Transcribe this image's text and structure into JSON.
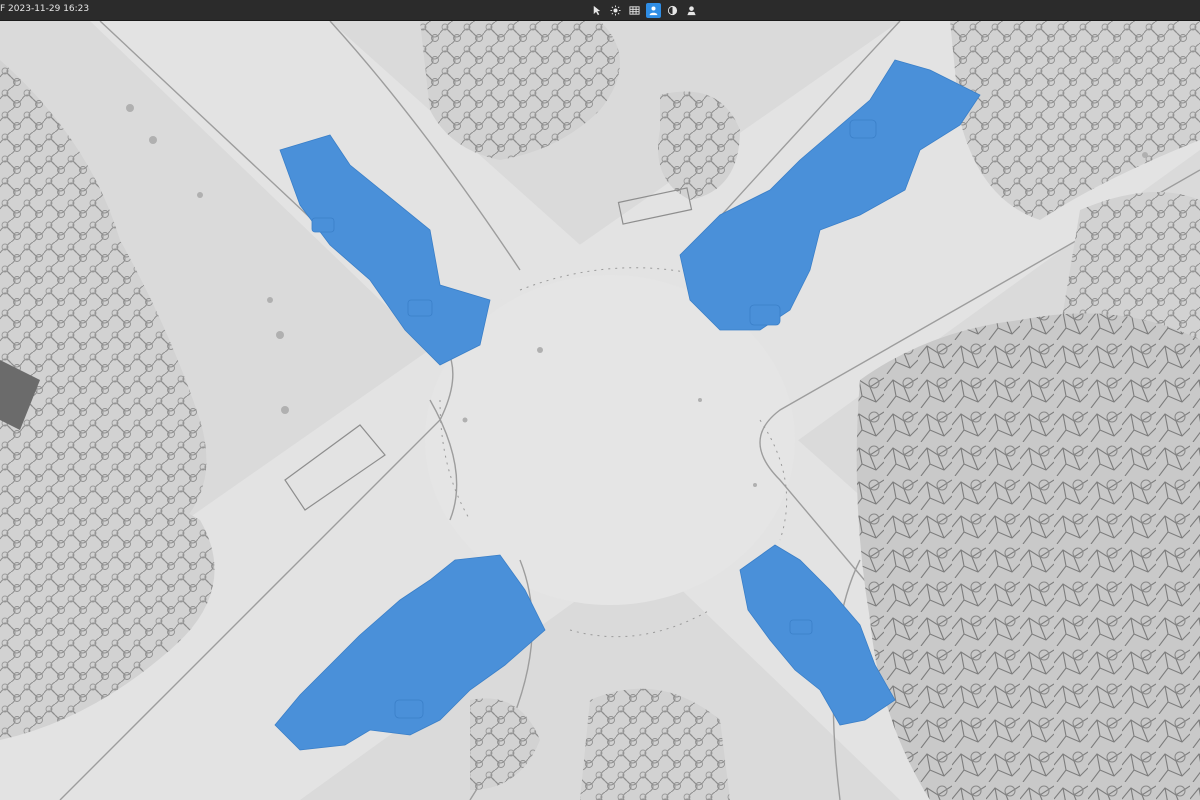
{
  "window": {
    "title": "F 2023-11-29 16:23"
  },
  "toolbar": {
    "tools": [
      {
        "icon": "pointer-icon",
        "active": false
      },
      {
        "icon": "light-icon",
        "active": false
      },
      {
        "icon": "grid-icon",
        "active": false
      },
      {
        "icon": "person-icon",
        "active": true
      },
      {
        "icon": "shade-icon",
        "active": false
      },
      {
        "icon": "profile-icon",
        "active": false
      }
    ]
  },
  "viewport": {
    "content": "3D mesh of a road intersection with parking lots",
    "highlight_color": "#4a90d9",
    "mesh_color": "#d8d8d8"
  }
}
